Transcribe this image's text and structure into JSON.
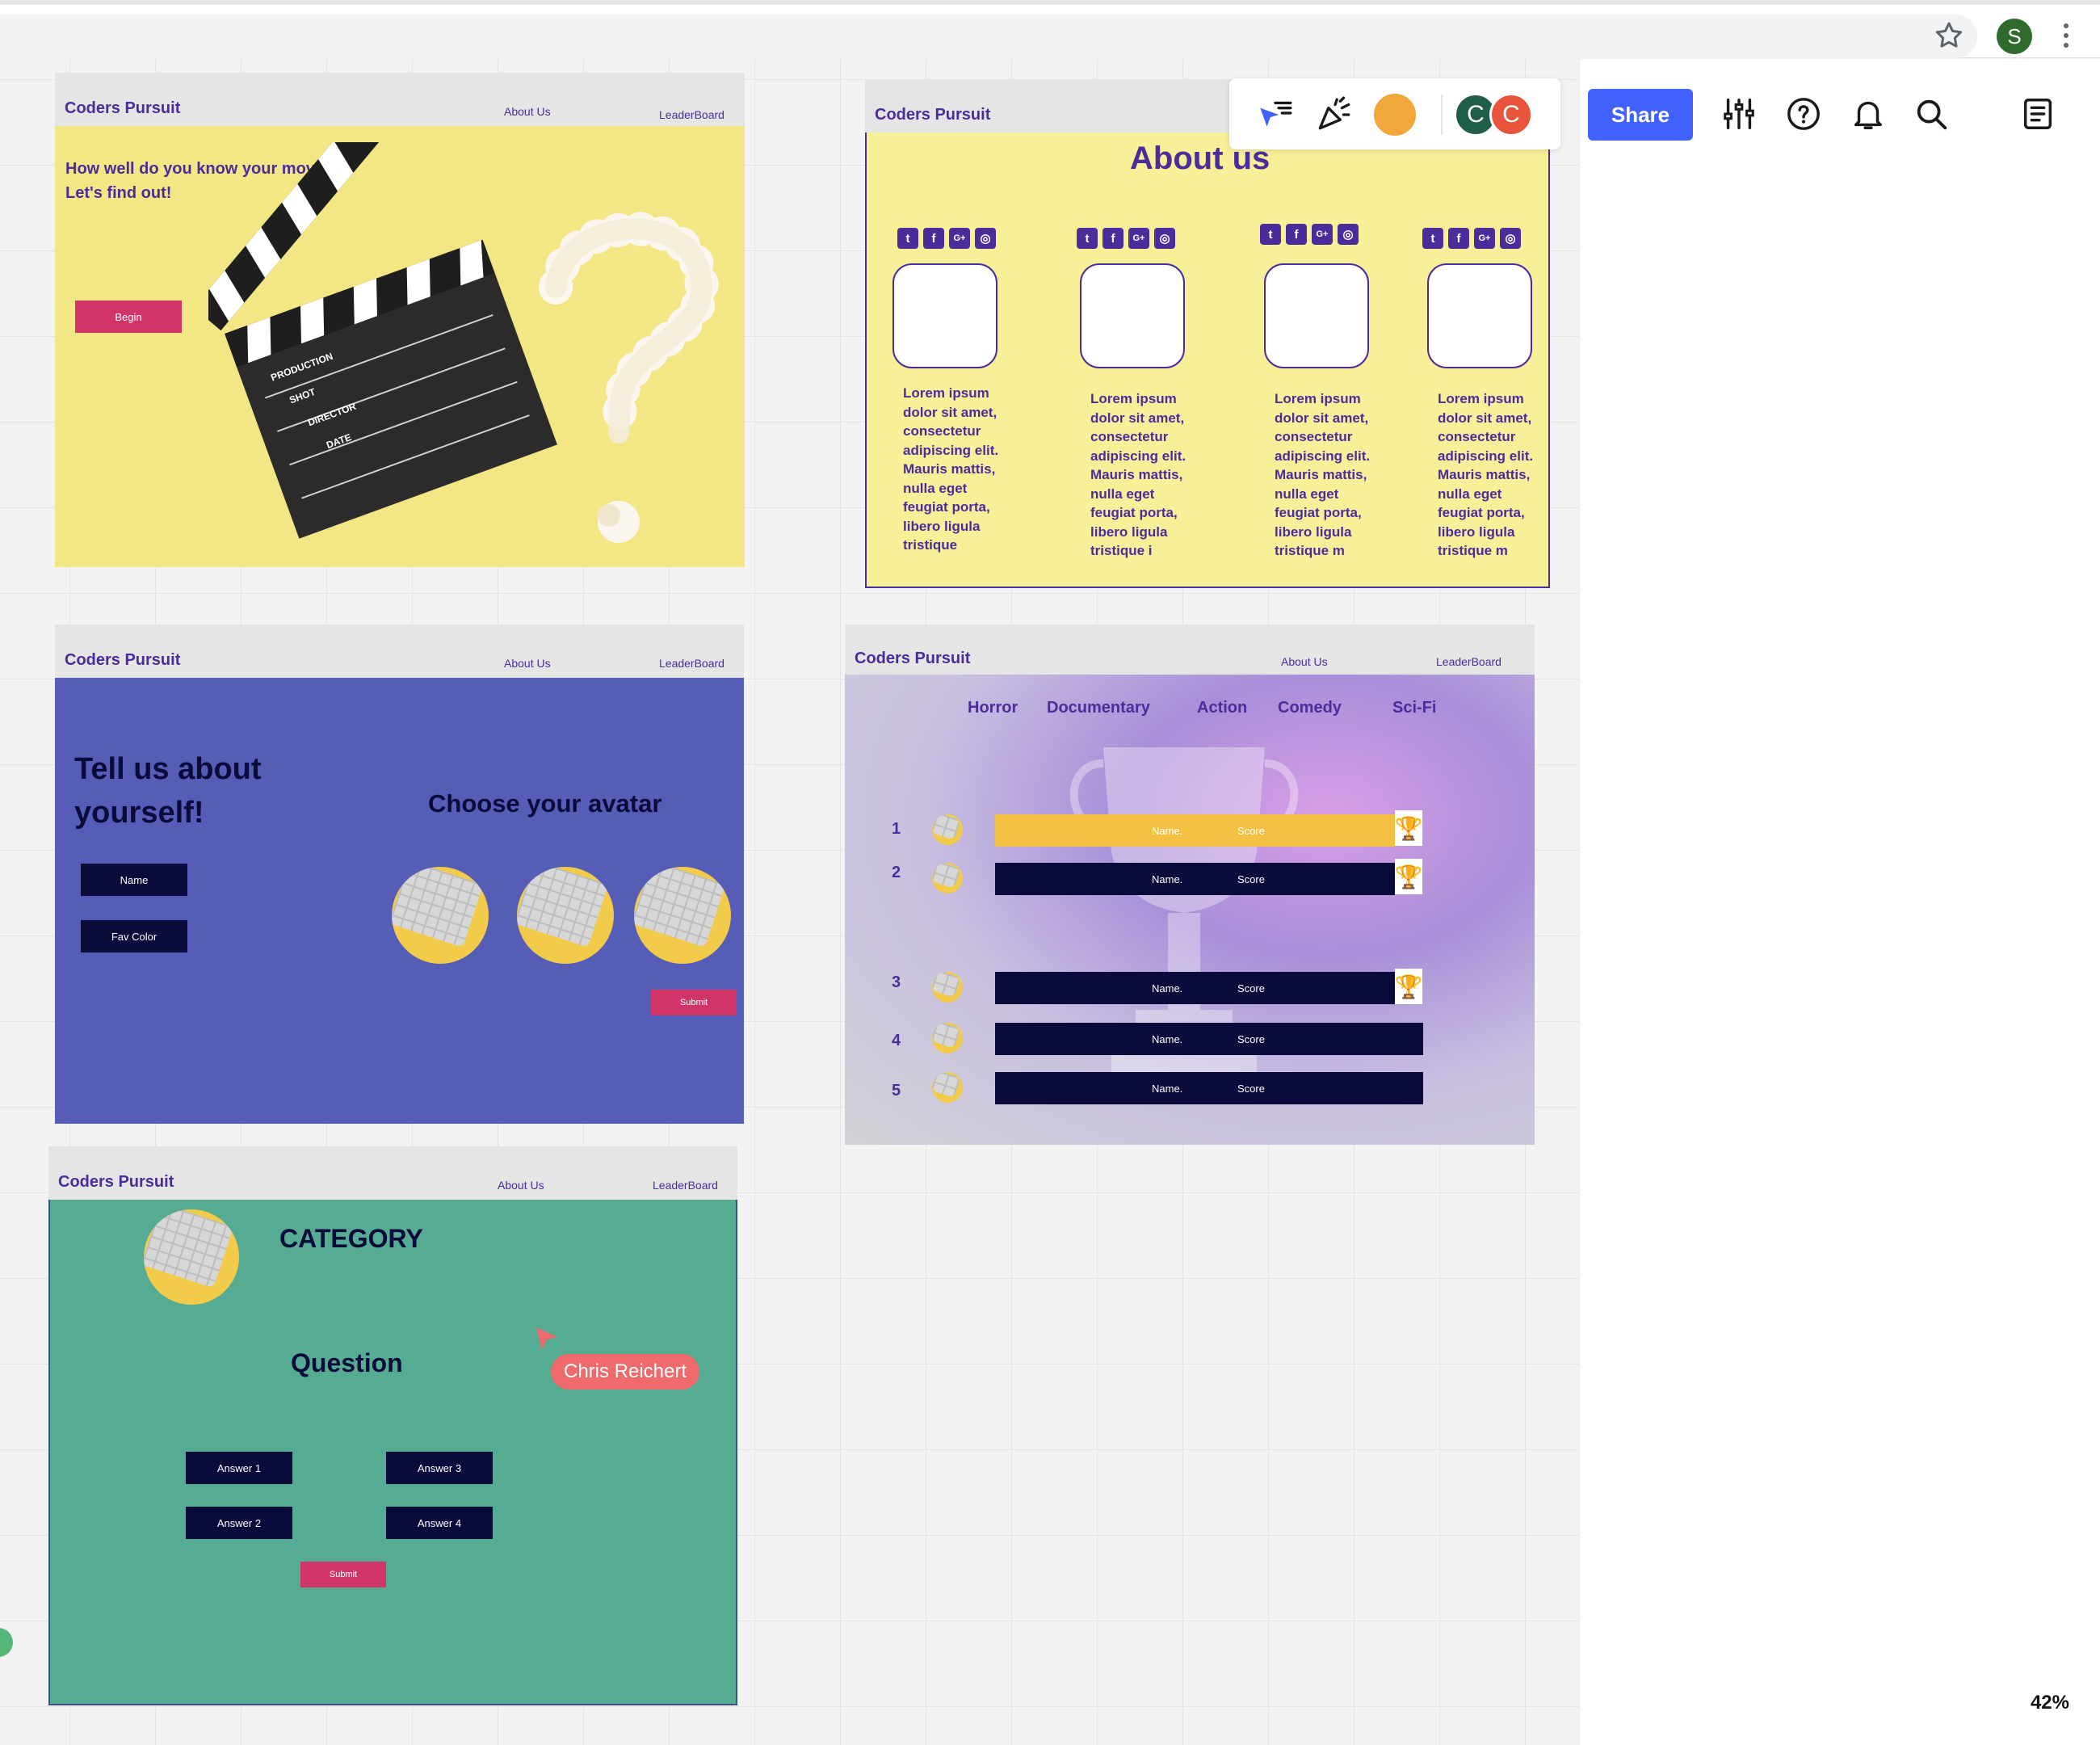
{
  "browser": {
    "profile_initial": "S"
  },
  "collab": {
    "avatar1_initial": "C",
    "avatar2_initial": "C",
    "avatar1_color": "#1f5f4a",
    "avatar2_color": "#e8543c"
  },
  "toolbar": {
    "share_label": "Share",
    "zoom": "42%"
  },
  "cursor_label": "Chris Reichert",
  "nav": {
    "brand": "Coders Pursuit",
    "about": "About Us",
    "leaderboard": "LeaderBoard"
  },
  "frame_home": {
    "headline_line1": "How well do you know your movies?",
    "headline_line2": "Let's find out!",
    "begin_label": "Begin",
    "clapboard": [
      "PRODUCTION",
      "SHOT",
      "DIRECTOR",
      "DATE"
    ]
  },
  "frame_about": {
    "title": "About us",
    "social": [
      "t",
      "f",
      "G+",
      "◎"
    ],
    "members": [
      {
        "text": "Lorem ipsum dolor sit amet, consectetur adipiscing elit. Mauris mattis, nulla eget feugiat porta, libero ligula tristique"
      },
      {
        "text": "Lorem ipsum dolor sit amet, consectetur adipiscing elit. Mauris mattis, nulla eget feugiat porta, libero ligula tristique i"
      },
      {
        "text": "Lorem ipsum dolor sit amet, consectetur adipiscing elit. Mauris mattis, nulla eget feugiat porta, libero ligula tristique m"
      },
      {
        "text": "Lorem ipsum dolor sit amet, consectetur adipiscing elit. Mauris mattis, nulla eget feugiat porta, libero ligula tristique m"
      }
    ]
  },
  "frame_profile": {
    "heading_line1": "Tell us about",
    "heading_line2": "yourself!",
    "avatar_heading": "Choose your avatar",
    "name_label": "Name",
    "color_label": "Fav Color",
    "submit_label": "Submit"
  },
  "frame_leaderboard": {
    "genres": [
      "Horror",
      "Documentary",
      "Action",
      "Comedy",
      "Sci-Fi"
    ],
    "rows": [
      {
        "rank": "1",
        "name": "Name.",
        "score": "Score",
        "trophy": "🏆"
      },
      {
        "rank": "2",
        "name": "Name.",
        "score": "Score",
        "trophy": "🏆"
      },
      {
        "rank": "3",
        "name": "Name.",
        "score": "Score",
        "trophy": "🏆"
      },
      {
        "rank": "4",
        "name": "Name.",
        "score": "Score"
      },
      {
        "rank": "5",
        "name": "Name.",
        "score": "Score"
      }
    ]
  },
  "frame_question": {
    "category": "CATEGORY",
    "question": "Question",
    "answers": [
      "Answer 1",
      "Answer 3",
      "Answer 2",
      "Answer 4"
    ],
    "submit_label": "Submit"
  },
  "colors": {
    "brand_purple": "#4a2c9b",
    "home_bg": "#f3e685",
    "profile_bg": "#555db7",
    "question_bg": "#55ac93",
    "dark_button": "#0b0b3b",
    "pink_button": "#d13468",
    "gold": "#f2c142"
  }
}
